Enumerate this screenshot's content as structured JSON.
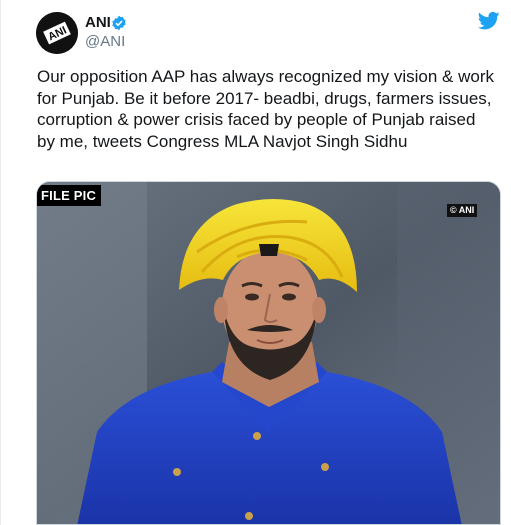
{
  "tweet": {
    "author_name": "ANI",
    "handle": "@ANI",
    "verified": true,
    "text": "Our opposition AAP has always recognized my vision & work for Punjab. Be it before 2017- beadbi, drugs, farmers issues, corruption & power crisis faced by people of Punjab raised by me, tweets Congress MLA Navjot Singh Sidhu",
    "avatar_logo_text": "ANI"
  },
  "media": {
    "tag_label": "FILE PIC",
    "credit_label": "© ANI"
  },
  "icons": {
    "platform": "twitter-bird-icon",
    "verified": "verified-badge-icon"
  },
  "colors": {
    "brand_blue": "#1da1f2",
    "turban_yellow": "#f2d21c",
    "shirt_blue": "#1f3fc2",
    "handle_gray": "#657786"
  }
}
